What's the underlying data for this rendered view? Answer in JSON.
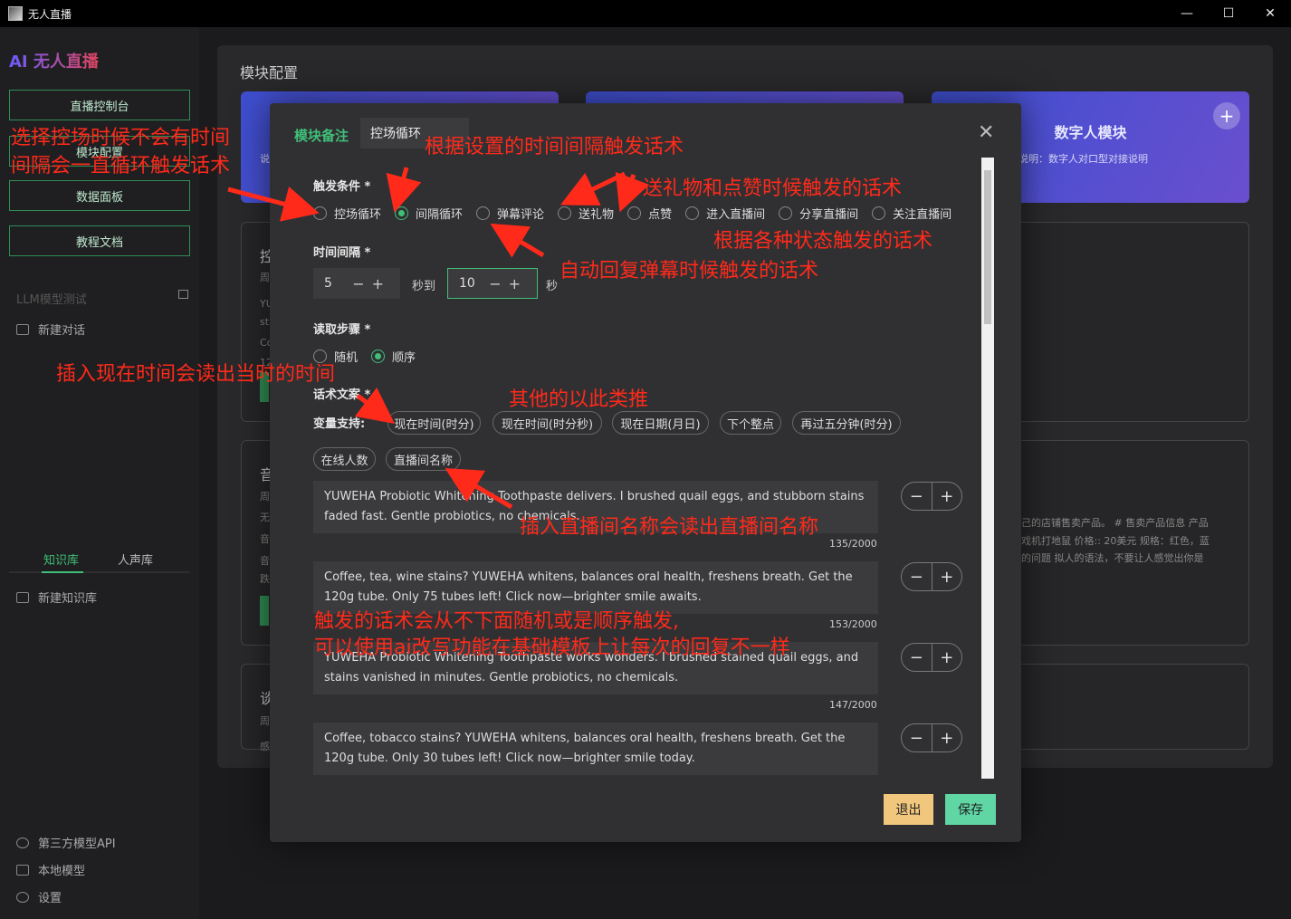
{
  "window": {
    "title": "无人直播",
    "minimize": "—",
    "maximize": "☐",
    "close": "✕"
  },
  "sidebar": {
    "brand": "AI 无人直播",
    "nav": [
      "直播控制台",
      "模块配置",
      "数据面板",
      "教程文档"
    ],
    "llm_label": "LLM模型测试",
    "new_chat": "新建对话",
    "tabs": [
      "知识库",
      "人声库"
    ],
    "new_kb": "新建知识库",
    "bottom": [
      "第三方模型API",
      "本地模型",
      "设置"
    ]
  },
  "main": {
    "title": "模块配置",
    "digital_module": {
      "title": "数字人模块",
      "desc": "说明：数字人对口型对接说明",
      "plus": "+"
    },
    "left_card_desc": "说",
    "panel1": [
      "控",
      "周",
      "YU",
      "st",
      "Co",
      "12"
    ],
    "panel2": [
      "音",
      "周",
      "无",
      "音",
      "音",
      "跌"
    ],
    "panel2_right": [
      "己的店铺售卖产品。 # 售卖产品信息 产品",
      "戏机打地鼠 价格:: 20美元 规格：红色，蓝",
      "的问题 拟人的语法，不要让人感觉出你是"
    ],
    "panel3": [
      "谈",
      "周",
      "感"
    ]
  },
  "modal": {
    "note_label": "模块备注",
    "note_value": "控场循环",
    "close": "✕",
    "trigger_label": "触发条件 *",
    "trigger_options": [
      "控场循环",
      "间隔循环",
      "弹幕评论",
      "送礼物",
      "点赞",
      "进入直播间",
      "分享直播间",
      "关注直播间"
    ],
    "interval_label": "时间间隔 *",
    "interval_from": "5",
    "interval_to": "10",
    "unit_to": "秒到",
    "unit_sec": "秒",
    "step_label": "读取步骤 *",
    "step_options": [
      "随机",
      "顺序"
    ],
    "script_label": "话术文案 *",
    "var_label": "变量支持:",
    "variables": [
      "现在时间(时分)",
      "现在时间(时分秒)",
      "现在日期(月日)",
      "下个整点",
      "再过五分钟(时分)",
      "在线人数",
      "直播间名称"
    ],
    "scripts": [
      {
        "text": "YUWEHA Probiotic Whitening Toothpaste delivers. I brushed quail eggs, and stubborn stains faded fast. Gentle probiotics, no chemicals.",
        "count": "135/2000"
      },
      {
        "text": "Coffee, tea, wine stains? YUWEHA whitens, balances oral health, freshens breath. Get the 120g tube.  Only 75 tubes left! Click now—brighter smile awaits.",
        "count": "153/2000"
      },
      {
        "text": "YUWEHA Probiotic Whitening Toothpaste works wonders. I brushed stained quail eggs, and stains vanished in minutes. Gentle probiotics, no chemicals.",
        "count": "147/2000"
      },
      {
        "text": "Coffee, tobacco stains? YUWEHA whitens, balances oral health, freshens breath. Get the 120g tube.  Only 30 tubes left! Click now—brighter smile today.",
        "count": ""
      }
    ],
    "minus": "−",
    "plus": "+",
    "exit": "退出",
    "save": "保存"
  },
  "annotations": {
    "a1_line1": "选择控场时候不会有时间",
    "a1_line2": "间隔会一直循环触发话术",
    "a2": "根据设置的时间间隔触发话术",
    "a3": "送礼物和点赞时候触发的话术",
    "a4": "根据各种状态触发的话术",
    "a5": "自动回复弹幕时候触发的话术",
    "a6": "插入现在时间会读出当时的时间",
    "a7": "其他的以此类推",
    "a8": "插入直播间名称会读出直播间名称",
    "a9_line1": "触发的话术会从不下面随机或是顺序触发,",
    "a9_line2": "可以使用ai改写功能在基础模板上让每次的回复不一样"
  }
}
